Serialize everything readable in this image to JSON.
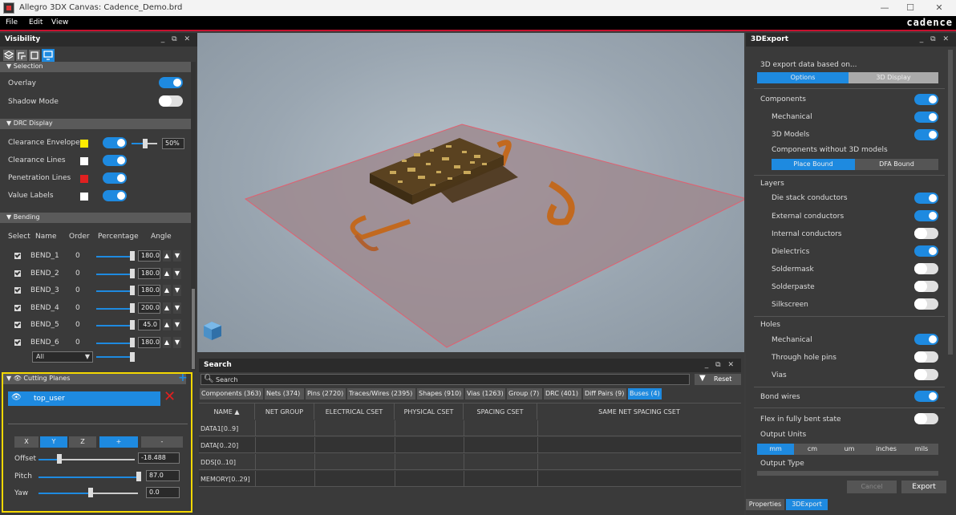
{
  "window": {
    "title": "Allegro 3DX Canvas: Cadence_Demo.brd",
    "minimize": "—",
    "maximize": "☐",
    "close": "✕"
  },
  "menu": {
    "items": [
      "File",
      "Edit",
      "View"
    ],
    "logo": "cadence"
  },
  "visibility": {
    "title": "Visibility",
    "controls": "_ ⧉ ✕",
    "selection_header": "▼ Selection",
    "overlay": "Overlay",
    "shadow_mode": "Shadow Mode",
    "drc_header": "▼  DRC Display",
    "clearance_envelopes": "Clearance Envelopes",
    "clearance_pct": "50%",
    "clearance_lines": "Clearance Lines",
    "penetration_lines": "Penetration Lines",
    "value_labels": "Value Labels",
    "bending_header": "▼  Bending",
    "bend_cols": {
      "select": "Select",
      "name": "Name",
      "order": "Order",
      "percentage": "Percentage",
      "angle": "Angle"
    },
    "bends": [
      {
        "name": "BEND_1",
        "order": "0",
        "angle": "180.0"
      },
      {
        "name": "BEND_2",
        "order": "0",
        "angle": "180.0"
      },
      {
        "name": "BEND_3",
        "order": "0",
        "angle": "180.0"
      },
      {
        "name": "BEND_4",
        "order": "0",
        "angle": "200.0"
      },
      {
        "name": "BEND_5",
        "order": "0",
        "angle": "45.0"
      },
      {
        "name": "BEND_6",
        "order": "0",
        "angle": "180.0"
      }
    ],
    "bend_all": "All",
    "cutting_header": "Cutting Planes",
    "plus": "+",
    "plane_name": "top_user",
    "axes": [
      "X",
      "Y",
      "Z",
      "+",
      "-"
    ],
    "offset_label": "Offset",
    "offset_value": "-18.488",
    "pitch_label": "Pitch",
    "pitch_value": "87.0",
    "yaw_label": "Yaw",
    "yaw_value": "0.0"
  },
  "search": {
    "title": "Search",
    "controls": "_ ⧉ ✕",
    "placeholder": "Search",
    "reset": "Reset",
    "tabs": [
      "Components (363)",
      "Nets (374)",
      "Pins (2720)",
      "Traces/Wires (2395)",
      "Shapes (910)",
      "Vias (1263)",
      "Group (7)",
      "DRC (401)",
      "Diff Pairs (9)",
      "Buses (4)"
    ],
    "columns": [
      "NAME",
      "NET GROUP",
      "ELECTRICAL CSET",
      "PHYSICAL CSET",
      "SPACING CSET",
      "SAME NET SPACING CSET"
    ],
    "rows": [
      "DATA1[0..9]",
      "DATA[0..20]",
      "DDS[0..10]",
      "MEMORY[0..29]"
    ]
  },
  "export": {
    "title": "3DExport",
    "controls": "_ ⧉ ✕",
    "based_on": "3D export data based on...",
    "options": "Options",
    "display": "3D Display",
    "components": "Components",
    "mechanical": "Mechanical",
    "models": "3D Models",
    "without": "Components without 3D models",
    "place_bound": "Place Bound",
    "dfa_bound": "DFA Bound",
    "layers": "Layers",
    "die_stack": "Die stack conductors",
    "external": "External conductors",
    "internal": "Internal conductors",
    "dielectrics": "Dielectrics",
    "soldermask": "Soldermask",
    "solderpaste": "Solderpaste",
    "silkscreen": "Silkscreen",
    "holes": "Holes",
    "holes_mech": "Mechanical",
    "through_hole": "Through hole pins",
    "vias": "Vias",
    "bond_wires": "Bond wires",
    "flex": "Flex in fully bent state",
    "output_units": "Output Units",
    "units": [
      "mm",
      "cm",
      "um",
      "inches",
      "mils"
    ],
    "output_type": "Output Type",
    "cancel": "Cancel",
    "export_btn": "Export",
    "tab_properties": "Properties",
    "tab_export": "3DExport"
  }
}
